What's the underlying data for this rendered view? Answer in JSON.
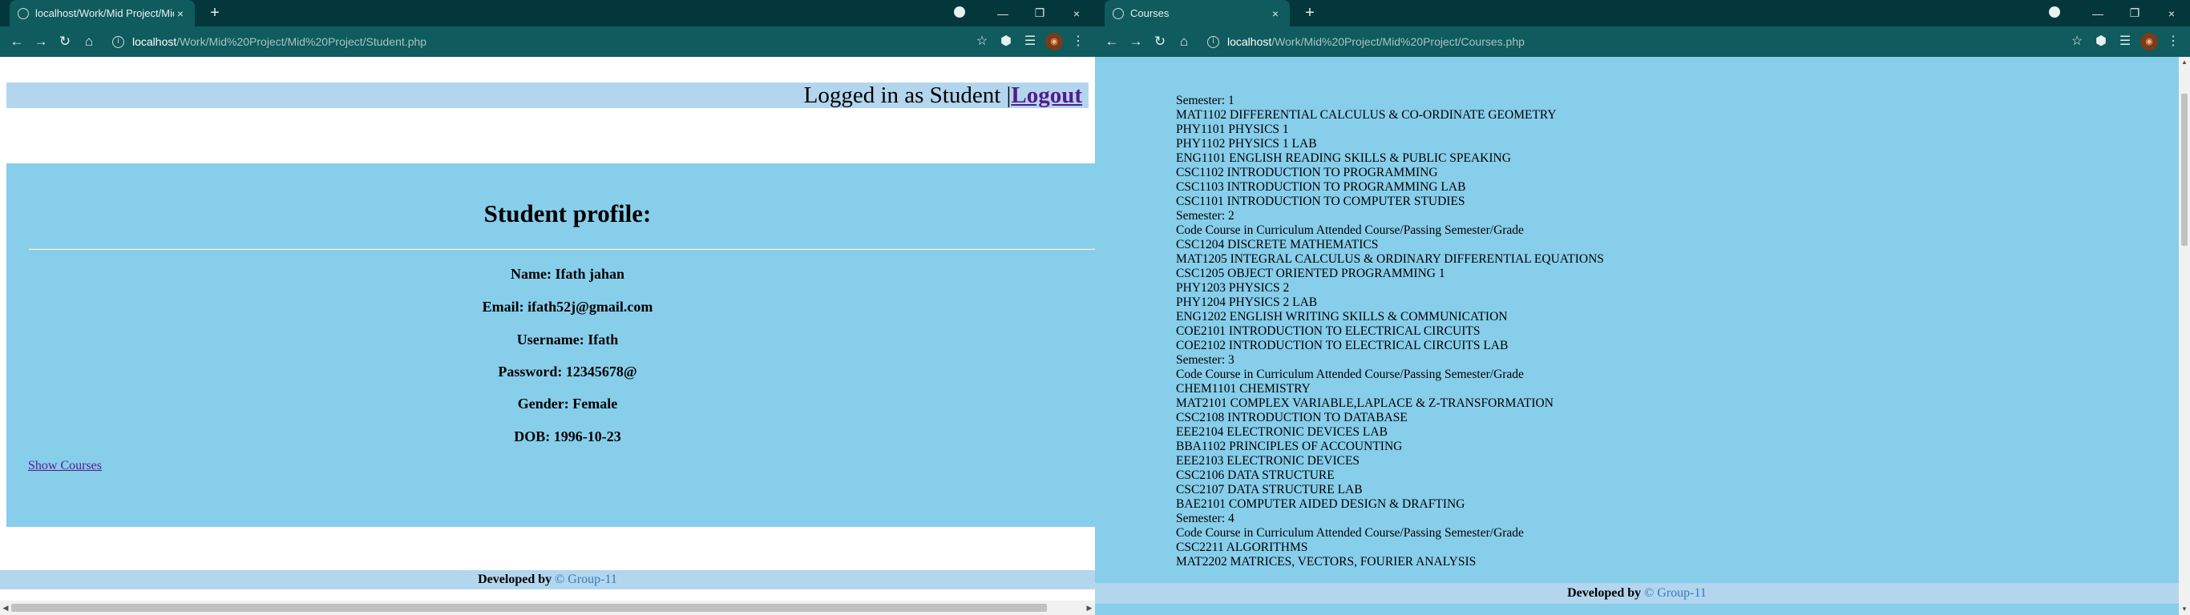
{
  "left": {
    "tab": {
      "title": "localhost/Work/Mid Project/Mid"
    },
    "address": {
      "host": "localhost",
      "path": "/Work/Mid%20Project/Mid%20Project/Student.php"
    },
    "header": {
      "logged_in_text": "Logged in as  Student |",
      "logout_label": "Logout"
    },
    "profile": {
      "title": "Student profile:",
      "fields": [
        "Name: Ifath jahan",
        "Email: ifath52j@gmail.com",
        "Username: Ifath",
        "Password: 12345678@",
        "Gender: Female",
        "DOB: 1996-10-23"
      ],
      "show_courses_label": "Show Courses"
    },
    "footer": {
      "developed_by": "Developed by ",
      "group": "© Group-11"
    }
  },
  "right": {
    "tab": {
      "title": "Courses"
    },
    "address": {
      "host": "localhost",
      "path": "/Work/Mid%20Project/Mid%20Project/Courses.php"
    },
    "course_lines": [
      "Semester: 1",
      "MAT1102 DIFFERENTIAL CALCULUS & CO-ORDINATE GEOMETRY",
      "PHY1101 PHYSICS 1",
      "PHY1102 PHYSICS 1 LAB",
      "ENG1101 ENGLISH READING SKILLS & PUBLIC SPEAKING",
      "CSC1102 INTRODUCTION TO PROGRAMMING",
      "CSC1103 INTRODUCTION TO PROGRAMMING LAB",
      "CSC1101 INTRODUCTION TO COMPUTER STUDIES",
      "Semester: 2",
      "Code Course in Curriculum Attended Course/Passing Semester/Grade",
      "CSC1204 DISCRETE MATHEMATICS",
      "MAT1205 INTEGRAL CALCULUS & ORDINARY DIFFERENTIAL EQUATIONS",
      "CSC1205 OBJECT ORIENTED PROGRAMMING 1",
      "PHY1203 PHYSICS 2",
      "PHY1204 PHYSICS 2 LAB",
      "ENG1202 ENGLISH WRITING SKILLS & COMMUNICATION",
      "COE2101 INTRODUCTION TO ELECTRICAL CIRCUITS",
      "COE2102 INTRODUCTION TO ELECTRICAL CIRCUITS LAB",
      "Semester: 3",
      "Code Course in Curriculum Attended Course/Passing Semester/Grade",
      "CHEM1101 CHEMISTRY",
      "MAT2101 COMPLEX VARIABLE,LAPLACE & Z-TRANSFORMATION",
      "CSC2108 INTRODUCTION TO DATABASE",
      "EEE2104 ELECTRONIC DEVICES LAB",
      "BBA1102 PRINCIPLES OF ACCOUNTING",
      "EEE2103 ELECTRONIC DEVICES",
      "CSC2106 DATA STRUCTURE",
      "CSC2107 DATA STRUCTURE LAB",
      "BAE2101 COMPUTER AIDED DESIGN & DRAFTING",
      "Semester: 4",
      "Code Course in Curriculum Attended Course/Passing Semester/Grade",
      "CSC2211 ALGORITHMS",
      "MAT2202 MATRICES, VECTORS, FOURIER ANALYSIS"
    ],
    "footer": {
      "developed_by": "Developed by ",
      "group": "© Group-11"
    }
  },
  "icons": {
    "close": "×",
    "new_tab": "+",
    "minimize": "—",
    "restore": "❐",
    "back": "←",
    "forward": "→",
    "reload": "↻",
    "home": "⌂",
    "star": "☆",
    "extensions": "⬢",
    "reading_list": "☰",
    "menu": "⋮",
    "info": "i",
    "avatar": "◉"
  },
  "colors": {
    "tabstrip": "#04373b",
    "toolbar": "#0f5b5e",
    "panel": "#87ceeb",
    "bar": "#b3d6ee",
    "link": "#551a8b",
    "group": "#2f7dbd"
  }
}
